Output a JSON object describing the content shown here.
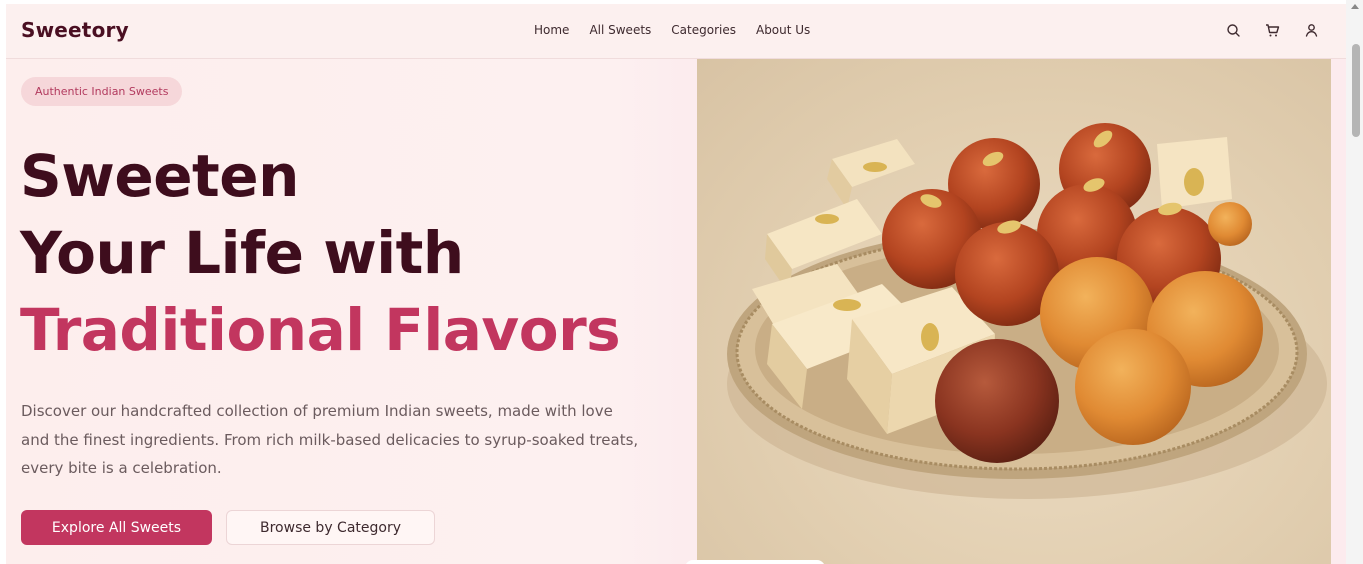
{
  "header": {
    "brand": "Sweetory",
    "nav": [
      "Home",
      "All Sweets",
      "Categories",
      "About Us"
    ],
    "icons": [
      "search-icon",
      "cart-icon",
      "user-icon"
    ]
  },
  "hero": {
    "badge": "Authentic Indian Sweets",
    "headline": [
      "Sweeten",
      "Your Life with",
      "Traditional Flavors"
    ],
    "description": "Discover our handcrafted collection of premium Indian sweets, made with love and the finest ingredients. From rich milk-based delicacies to syrup-soaked treats, every bite is a celebration.",
    "primary_button": "Explore All Sweets",
    "secondary_button": "Browse by Category"
  },
  "colors": {
    "brand": "#4a0f22",
    "accent": "#c2365f",
    "badge_bg": "#f6d7da"
  }
}
